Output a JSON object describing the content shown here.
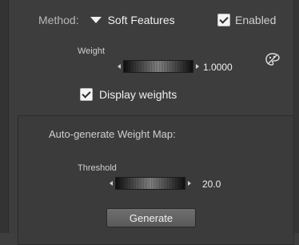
{
  "method": {
    "label": "Method:",
    "value": "Soft Features"
  },
  "enabled": {
    "label": "Enabled",
    "checked": true
  },
  "weight": {
    "label": "Weight",
    "value": "1.0000"
  },
  "display_weights": {
    "label": "Display weights",
    "checked": true
  },
  "auto_generate": {
    "title": "Auto-generate Weight Map:",
    "threshold": {
      "label": "Threshold",
      "value": "20.0"
    },
    "generate_label": "Generate"
  },
  "icons": {
    "palette": "palette-icon",
    "dropdown": "chevron-down-icon",
    "check": "check-icon"
  }
}
